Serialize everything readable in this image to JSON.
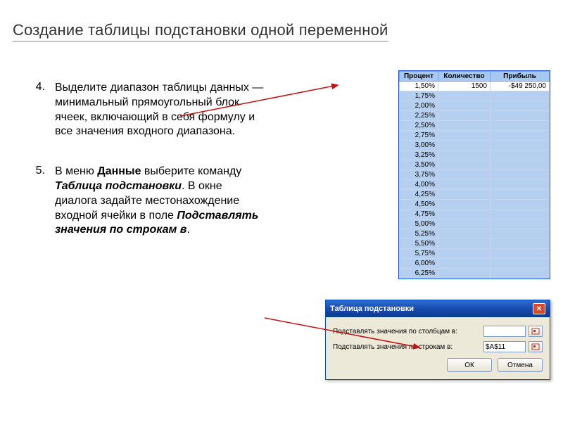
{
  "title": "Создание таблицы подстановки одной переменной",
  "items": [
    {
      "num": "4.",
      "parts": [
        {
          "t": "Выделите диапазон таблицы данных — минимальный прямоугольный блок ячеек, включающий в себя формулу и все значения входного диапазона.",
          "b": false,
          "i": false
        }
      ]
    },
    {
      "num": "5.",
      "parts": [
        {
          "t": "В меню ",
          "b": false,
          "i": false
        },
        {
          "t": "Данные",
          "b": true,
          "i": false
        },
        {
          "t": " выберите команду ",
          "b": false,
          "i": false
        },
        {
          "t": "Таблица подстановки",
          "b": true,
          "i": true
        },
        {
          "t": ". В окне диалога задайте местонахождение входной ячейки в поле ",
          "b": false,
          "i": false
        },
        {
          "t": "Подставлять значения по строкам в",
          "b": true,
          "i": true
        },
        {
          "t": ".",
          "b": false,
          "i": false
        }
      ]
    }
  ],
  "excel": {
    "headers": [
      "Процент",
      "Количество",
      "Прибыль"
    ],
    "first_row": {
      "percent": "1,50%",
      "qty": "1500",
      "profit": "-$49 250,00"
    },
    "percents": [
      "1,75%",
      "2,00%",
      "2,25%",
      "2,50%",
      "2,75%",
      "3,00%",
      "3,25%",
      "3,50%",
      "3,75%",
      "4,00%",
      "4,25%",
      "4,50%",
      "4,75%",
      "5,00%",
      "5,25%",
      "5,50%",
      "5,75%",
      "6,00%",
      "6,25%"
    ]
  },
  "dialog": {
    "title": "Таблица подстановки",
    "row_col_label": "Подставлять значения по столбцам в:",
    "row_row_label": "Подставлять значения по строкам в:",
    "row_col_value": "",
    "row_row_value": "$A$11",
    "ok": "ОК",
    "cancel": "Отмена"
  }
}
